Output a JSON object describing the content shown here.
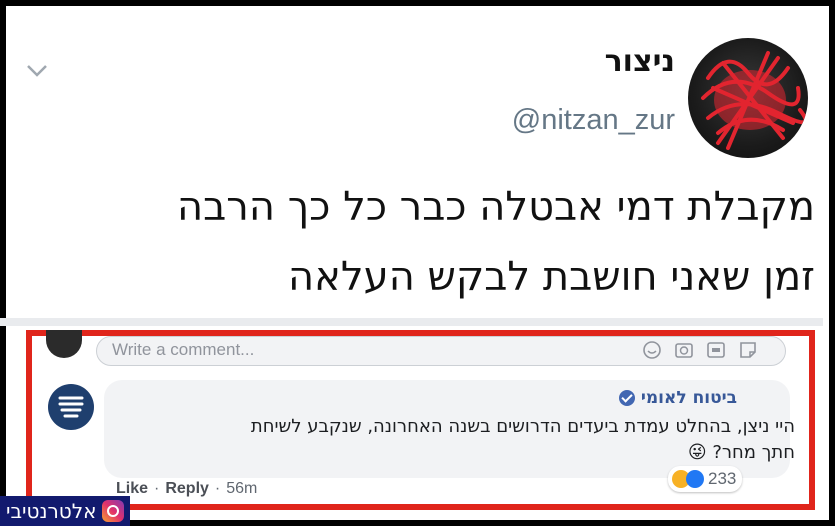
{
  "tweet": {
    "name": "ניצור",
    "handle": "@nitzan_zur",
    "text_line1": "מקבלת דמי אבטלה כבר כל כך הרבה",
    "text_line2": "זמן שאני חושבת לבקש העלאה"
  },
  "comment_box": {
    "placeholder": "Write a comment..."
  },
  "comment": {
    "author": "ביטוח לאומי",
    "text_line1": "היי ניצן, בהחלט עמדת ביעדים הדרושים בשנה האחרונה, שנקבע לשיחת",
    "text_line2": "חתך מחר? 😜",
    "reaction_count": "233",
    "like_label": "Like",
    "reply_label": "Reply",
    "time": "56m"
  },
  "watermark": {
    "text": "אלטרנטיבי"
  },
  "colors": {
    "highlight_frame": "#e0251b",
    "fb_link": "#385898",
    "watermark_bg": "#121a6e"
  }
}
